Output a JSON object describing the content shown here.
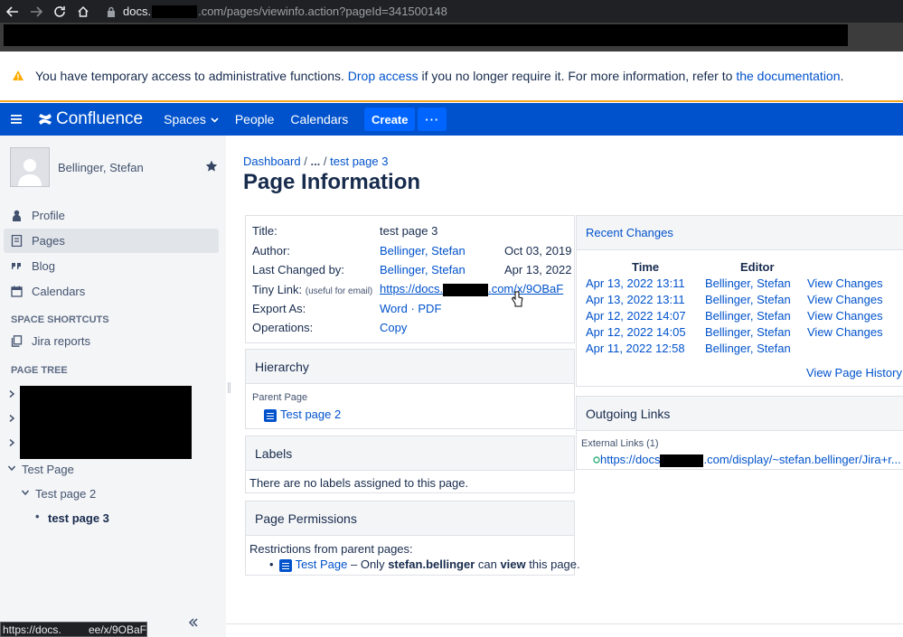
{
  "browser": {
    "url_host": "docs.",
    "url_path": ".com/pages/viewinfo.action?pageId=341500148",
    "status_tooltip_start": "https://docs.",
    "status_tooltip_end": "ee/x/9OBaF"
  },
  "banner": {
    "text_before": "You have temporary access to administrative functions. ",
    "drop_access": "Drop access",
    "text_middle": " if you no longer require it. For more information, refer to ",
    "documentation": "the documentation",
    "text_end": "."
  },
  "header": {
    "logo": "Confluence",
    "spaces": "Spaces",
    "people": "People",
    "calendars": "Calendars",
    "create": "Create",
    "more": "···",
    "color": "#0052cc"
  },
  "sidebar": {
    "user_name": "Bellinger, Stefan",
    "items": [
      {
        "label": "Profile",
        "icon": "person-icon"
      },
      {
        "label": "Pages",
        "icon": "pages-icon"
      },
      {
        "label": "Blog",
        "icon": "quote-icon"
      },
      {
        "label": "Calendars",
        "icon": "calendar-icon"
      }
    ],
    "shortcuts_heading": "SPACE SHORTCUTS",
    "shortcut": "Jira reports",
    "tree_heading": "PAGE TREE",
    "tree": [
      "Test Page",
      "Test page 2",
      "test page 3"
    ]
  },
  "breadcrumb": {
    "dashboard": "Dashboard",
    "sep": " / ",
    "ellipsis": "...",
    "current": "test page 3"
  },
  "page_title": "Page Information",
  "info": {
    "title_label": "Title:",
    "title_value": "test page 3",
    "author_label": "Author:",
    "author_value": "Bellinger, Stefan",
    "author_date": "Oct 03, 2019",
    "changed_label": "Last Changed by:",
    "changed_value": "Bellinger, Stefan",
    "changed_date": "Apr 13, 2022",
    "tiny_label": "Tiny Link:",
    "tiny_hint": "(useful for email)",
    "tiny_start": "https://docs.",
    "tiny_end": ".com/x/9OBaF",
    "export_label": "Export As:",
    "export_word": "Word",
    "export_sep": " · ",
    "export_pdf": "PDF",
    "ops_label": "Operations:",
    "ops_copy": "Copy"
  },
  "hierarchy": {
    "heading": "Hierarchy",
    "parent_label": "Parent Page",
    "parent": "Test page 2"
  },
  "labels": {
    "heading": "Labels",
    "text": "There are no labels assigned to this page."
  },
  "permissions": {
    "heading": "Page Permissions",
    "intro": "Restrictions from parent pages:",
    "page": "Test Page",
    "text1": " – Only ",
    "user": "stefan.bellinger",
    "text2": " can ",
    "perm": "view",
    "text3": " this page."
  },
  "recent": {
    "heading": "Recent Changes",
    "col_time": "Time",
    "col_editor": "Editor",
    "rows": [
      {
        "time": "Apr 13, 2022 13:11",
        "editor": "Bellinger, Stefan",
        "action": "View Changes"
      },
      {
        "time": "Apr 13, 2022 13:11",
        "editor": "Bellinger, Stefan",
        "action": "View Changes"
      },
      {
        "time": "Apr 12, 2022 14:07",
        "editor": "Bellinger, Stefan",
        "action": "View Changes"
      },
      {
        "time": "Apr 12, 2022 14:05",
        "editor": "Bellinger, Stefan",
        "action": "View Changes"
      },
      {
        "time": "Apr 11, 2022 12:58",
        "editor": "Bellinger, Stefan",
        "action": ""
      }
    ],
    "history": "View Page History"
  },
  "outgoing": {
    "heading": "Outgoing Links",
    "ext_label": "External Links (1)",
    "link_start": "https://docs",
    "link_end": ".com/display/~stefan.bellinger/Jira+r..."
  }
}
